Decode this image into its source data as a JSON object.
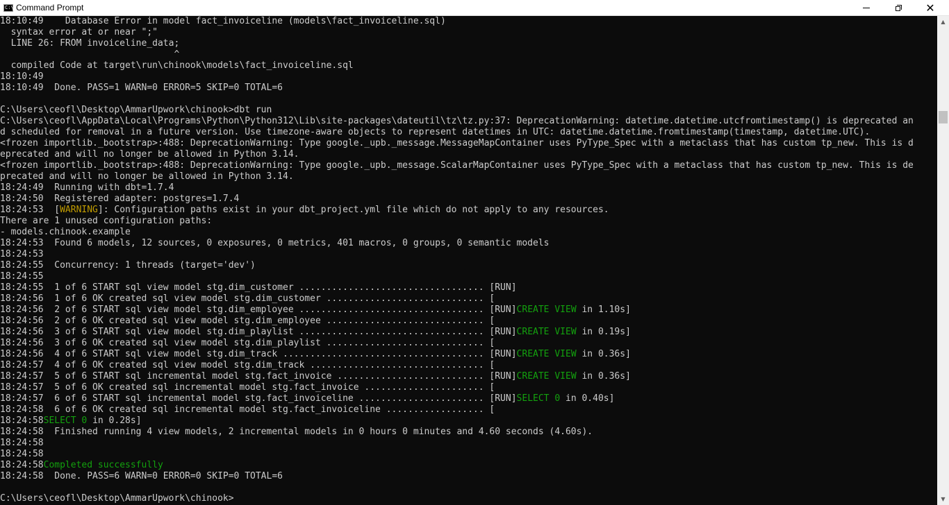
{
  "window": {
    "title": "Command Prompt",
    "icon": "cmd-icon",
    "icon_text": "C:\\",
    "minimize_glyph": "minimize-icon",
    "maximize_glyph": "maximize-icon",
    "close_glyph": "✕"
  },
  "console": {
    "lines": [
      "18:10:49    Database Error in model fact_invoiceline (models\\fact_invoiceline.sql)",
      "  syntax error at or near \";\"",
      "  LINE 26: FROM invoiceline_data;",
      "                                ^",
      "  compiled Code at target\\run\\chinook\\models\\fact_invoiceline.sql",
      "18:10:49",
      "18:10:49  Done. PASS=1 WARN=0 ERROR=5 SKIP=0 TOTAL=6",
      "",
      "C:\\Users\\ceofl\\Desktop\\AmmarUpwork\\chinook>dbt run",
      "C:\\Users\\ceofl\\AppData\\Local\\Programs\\Python\\Python312\\Lib\\site-packages\\dateutil\\tz\\tz.py:37: DeprecationWarning: datetime.datetime.utcfromtimestamp() is deprecated an",
      "d scheduled for removal in a future version. Use timezone-aware objects to represent datetimes in UTC: datetime.datetime.fromtimestamp(timestamp, datetime.UTC).",
      "<frozen importlib._bootstrap>:488: DeprecationWarning: Type google._upb._message.MessageMapContainer uses PyType_Spec with a metaclass that has custom tp_new. This is d",
      "eprecated and will no longer be allowed in Python 3.14.",
      "<frozen importlib._bootstrap>:488: DeprecationWarning: Type google._upb._message.ScalarMapContainer uses PyType_Spec with a metaclass that has custom tp_new. This is de",
      "precated and will no longer be allowed in Python 3.14.",
      "18:24:49  Running with dbt=1.7.4",
      "18:24:50  Registered adapter: postgres=1.7.4",
      "18:24:53  [",
      "There are 1 unused configuration paths:",
      "- models.chinook.example",
      "18:24:53  Found 6 models, 12 sources, 0 exposures, 0 metrics, 401 macros, 0 groups, 0 semantic models",
      "18:24:53",
      "18:24:55  Concurrency: 1 threads (target='dev')",
      "18:24:55",
      "18:24:55  1 of 6 START sql view model stg.dim_customer .................................. [RUN]",
      "18:24:56  1 of 6 OK created sql view model stg.dim_customer ............................. [",
      "18:24:56  2 of 6 START sql view model stg.dim_employee .................................. [RUN]",
      "18:24:56  2 of 6 OK created sql view model stg.dim_employee ............................. [",
      "18:24:56  3 of 6 START sql view model stg.dim_playlist .................................. [RUN]",
      "18:24:56  3 of 6 OK created sql view model stg.dim_playlist ............................. [",
      "18:24:56  4 of 6 START sql view model stg.dim_track ..................................... [RUN]",
      "18:24:57  4 of 6 OK created sql view model stg.dim_track ................................ [",
      "18:24:57  5 of 6 START sql incremental model stg.fact_invoice ........................... [RUN]",
      "18:24:57  5 of 6 OK created sql incremental model stg.fact_invoice ...................... [",
      "18:24:57  6 of 6 START sql incremental model stg.fact_invoiceline ....................... [RUN]",
      "18:24:58  6 of 6 OK created sql incremental model stg.fact_invoiceline .................. [",
      "18:24:58",
      "18:24:58  Finished running 4 view models, 2 incremental models in 0 hours 0 minutes and 4.60 seconds (4.60s).",
      "18:24:58",
      "18:24:58  ",
      "18:24:58",
      "18:24:58  Done. PASS=6 WARN=0 ERROR=0 SKIP=0 TOTAL=6",
      "",
      "C:\\Users\\ceofl\\Desktop\\AmmarUpwork\\chinook>"
    ],
    "warning_word": "WARNING",
    "warning_rest": "]: Configuration paths exist in your dbt_project.yml file which do not apply to any resources.",
    "status_create_view": "CREATE VIEW",
    "status_select_0": "SELECT 0",
    "times": {
      "dim_customer": " in 1.10s]",
      "dim_employee": " in 0.19s]",
      "dim_playlist": " in 0.36s]",
      "dim_track": " in 0.36s]",
      "fact_invoice": " in 0.40s]",
      "fact_invoiceline": " in 0.28s]"
    },
    "completed": "Completed successfully"
  },
  "colors": {
    "background": "#0c0c0c",
    "text": "#cccccc",
    "warning": "#c19c00",
    "success": "#13a10e"
  }
}
